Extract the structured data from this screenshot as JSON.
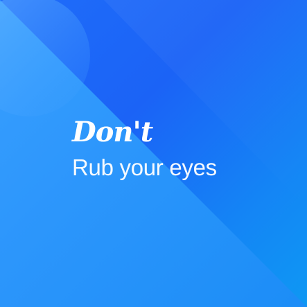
{
  "poster": {
    "headline": "Don't",
    "subline": "Rub your eyes"
  },
  "colors": {
    "background_dark": "#1b63f6",
    "background_light": "#0e98f3",
    "text": "#ffffff"
  }
}
